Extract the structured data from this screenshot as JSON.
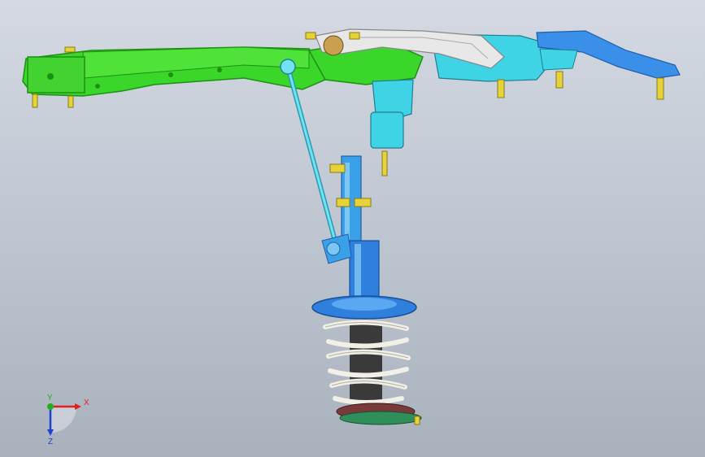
{
  "viewport": {
    "background_top": "#d4d9e2",
    "background_bottom": "#a9b1bd"
  },
  "model": {
    "colors": {
      "subframe": "#3bd62a",
      "subframe_dark": "#1e8f14",
      "crossmember": "#e8e8e8",
      "cyan_parts": "#3fd3e6",
      "strut_blue": "#2f7fdc",
      "bolts": "#e6d23a",
      "spring": "#f2f0e6",
      "bump_stop": "#3a3a3a",
      "lower_seat": "#7a3a3a"
    }
  },
  "triad": {
    "x_label": "X",
    "y_label": "Y",
    "z_label": "Z",
    "x_color": "#e02020",
    "y_color": "#20b020",
    "z_color": "#2040d0"
  }
}
